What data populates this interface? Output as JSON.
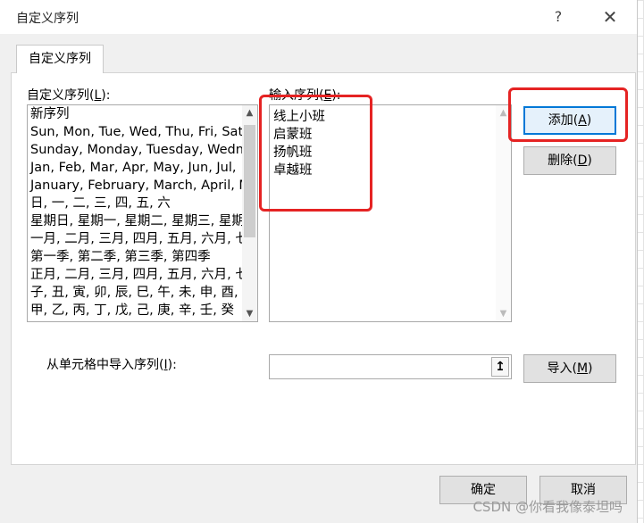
{
  "window": {
    "title": "自定义序列",
    "help_label": "?",
    "close_label": "✕"
  },
  "tab": {
    "label": "自定义序列"
  },
  "custom_lists": {
    "label_pre": "自定义序列(",
    "label_key": "L",
    "label_post": "):",
    "items": [
      "新序列",
      "Sun, Mon, Tue, Wed, Thu, Fri, Sat",
      "Sunday, Monday, Tuesday, Wednesday",
      "Jan, Feb, Mar, Apr, May, Jun, Jul,",
      "January, February, March, April, May",
      "日, 一, 二, 三, 四, 五, 六",
      "星期日, 星期一, 星期二, 星期三, 星期四",
      "一月, 二月, 三月, 四月, 五月, 六月, 七月",
      "第一季, 第二季, 第三季, 第四季",
      "正月, 二月, 三月, 四月, 五月, 六月, 七月",
      "子, 丑, 寅, 卯, 辰, 巳, 午, 未, 申, 酉, 戌",
      "甲, 乙, 丙, 丁, 戊, 己, 庚, 辛, 壬, 癸"
    ],
    "scroll_up_icon": "▲",
    "scroll_down_icon": "▼"
  },
  "list_entries": {
    "label_pre": "输入序列(",
    "label_key": "E",
    "label_post": "):",
    "entries": [
      "线上小班",
      "启蒙班",
      "扬帆班",
      "卓越班"
    ],
    "scroll_up_icon": "▲",
    "scroll_down_icon": "▼"
  },
  "buttons": {
    "add_pre": "添加(",
    "add_key": "A",
    "add_post": ")",
    "delete_pre": "删除(",
    "delete_key": "D",
    "delete_post": ")",
    "import_pre": "导入(",
    "import_key": "M",
    "import_post": ")",
    "ok": "确定",
    "cancel": "取消"
  },
  "import_range": {
    "label_pre": "从单元格中导入序列(",
    "label_key": "I",
    "label_post": "):",
    "value": "",
    "picker_icon": "↥"
  },
  "watermark": "CSDN @你看我像泰坦吗",
  "colors": {
    "highlight_red": "#e52323",
    "default_button_border": "#0078d7",
    "dialog_bg": "#f0f0f0"
  }
}
